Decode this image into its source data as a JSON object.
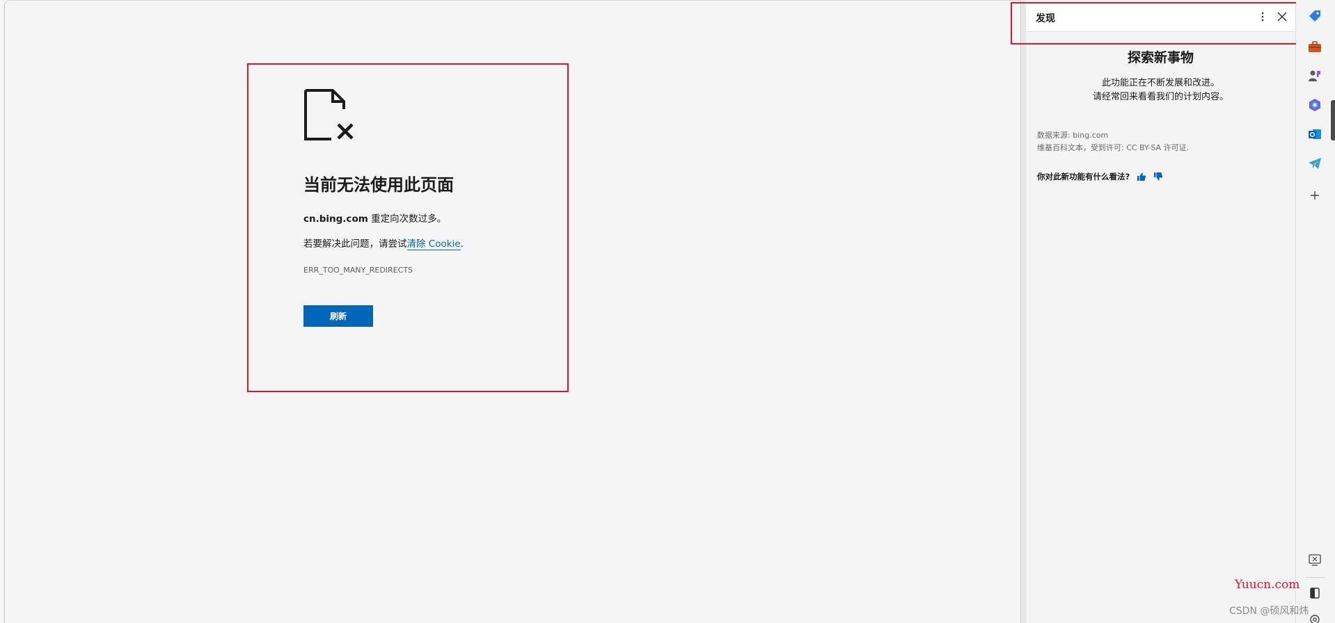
{
  "error_page": {
    "title": "当前无法使用此页面",
    "host": "cn.bing.com",
    "host_message": " 重定向次数过多。",
    "fix_prefix": "若要解决此问题，请尝试",
    "fix_link": "清除 Cookie",
    "fix_suffix": ".",
    "error_code": "ERR_TOO_MANY_REDIRECTS",
    "refresh_label": "刷新",
    "icon": "document-error-icon"
  },
  "discover_panel": {
    "header_title": "发现",
    "more_icon": "more-vertical-icon",
    "close_icon": "close-icon",
    "heading": "探索新事物",
    "desc_line1": "此功能正在不断发展和改进。",
    "desc_line2": "请经常回来看看我们的计划内容。",
    "source_line1": "数据来源: bing.com",
    "source_line2": "维基百科文本，受到许可: CC BY-SA 许可证.",
    "feedback_question": "你对此新功能有什么看法?",
    "thumbs_up_icon": "thumbs-up-icon",
    "thumbs_down_icon": "thumbs-down-icon"
  },
  "sidebar": {
    "icons": [
      "shopping-tag-icon",
      "tools-briefcase-icon",
      "games-icon",
      "microsoft-365-icon",
      "outlook-icon",
      "telegram-icon",
      "add-icon",
      "screenshot-icon",
      "split-screen-icon",
      "settings-icon"
    ]
  },
  "watermarks": {
    "yuucn": "Yuucn.com",
    "csdn": "CSDN @硕风和炜"
  },
  "colors": {
    "accent_blue": "#0067b8",
    "highlight_red": "#d9162b",
    "background": "#f5f5f5"
  }
}
